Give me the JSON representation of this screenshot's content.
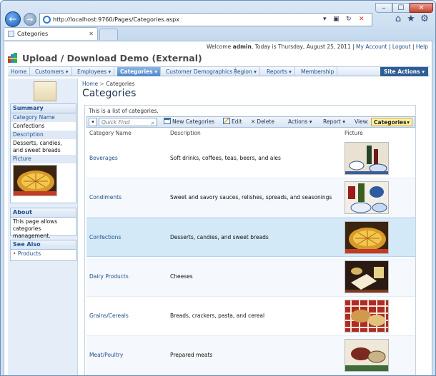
{
  "browser": {
    "url": "http://localhost:9760/Pages/Categories.aspx",
    "tab_title": "Categories",
    "window_buttons": {
      "minimize": "–",
      "maximize": "☐",
      "close": "✕"
    },
    "nav": {
      "back": "←",
      "forward": "→"
    },
    "toolbar_icons": [
      "home-icon",
      "favorites-star-icon",
      "tools-gear-icon"
    ]
  },
  "header": {
    "welcome_prefix": "Welcome",
    "user": "admin",
    "date_text": ", Today is Thursday, August 25, 2011 |",
    "links": [
      "My Account",
      "Logout",
      "Help"
    ],
    "app_title": "Upload / Download Demo (External)"
  },
  "menu": {
    "items": [
      {
        "label": "Home",
        "dropdown": false
      },
      {
        "label": "Customers",
        "dropdown": true
      },
      {
        "label": "Employees",
        "dropdown": true
      },
      {
        "label": "Categories",
        "dropdown": true,
        "active": true
      },
      {
        "label": "Customer Demographics",
        "dropdown": false
      },
      {
        "label": "Region",
        "dropdown": true
      },
      {
        "label": "Reports",
        "dropdown": true
      },
      {
        "label": "Membership",
        "dropdown": false
      }
    ],
    "site_actions": "Site Actions"
  },
  "sidebar": {
    "summary": {
      "title": "Summary",
      "category_name_label": "Category Name",
      "category_name_value": "Confections",
      "description_label": "Description",
      "description_value": "Desserts, candies, and sweet breads",
      "picture_label": "Picture"
    },
    "about": {
      "title": "About",
      "text": "This page allows categories management."
    },
    "see_also": {
      "title": "See Also",
      "links": [
        "Products"
      ]
    }
  },
  "page": {
    "breadcrumb": [
      "Home",
      "Categories"
    ],
    "title": "Categories",
    "description": "This is a list of categories."
  },
  "toolbar": {
    "quick_find_placeholder": "Quick Find",
    "new": "New Categories",
    "edit": "Edit",
    "delete": "Delete",
    "actions": "Actions",
    "report": "Report",
    "view_label": "View:",
    "view_value": "Categories"
  },
  "grid": {
    "columns": [
      "Category Name",
      "Description",
      "Picture"
    ],
    "rows": [
      {
        "name": "Beverages",
        "description": "Soft drinks, coffees, teas, beers, and ales",
        "picture": "beverages-photo"
      },
      {
        "name": "Condiments",
        "description": "Sweet and savory sauces, relishes, spreads, and seasonings",
        "picture": "condiments-photo"
      },
      {
        "name": "Confections",
        "description": "Desserts, candies, and sweet breads",
        "picture": "confections-photo",
        "selected": true
      },
      {
        "name": "Dairy Products",
        "description": "Cheeses",
        "picture": "dairy-photo"
      },
      {
        "name": "Grains/Cereals",
        "description": "Breads, crackers, pasta, and cereal",
        "picture": "grains-photo"
      },
      {
        "name": "Meat/Poultry",
        "description": "Prepared meats",
        "picture": "meat-photo"
      }
    ]
  }
}
